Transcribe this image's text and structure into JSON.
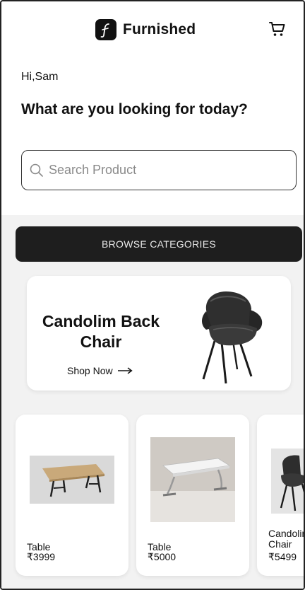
{
  "app": {
    "brand": "Furnished"
  },
  "greeting": "Hi,Sam",
  "headline": "What are you looking for today?",
  "search": {
    "placeholder": "Search Product",
    "value": ""
  },
  "browse_label": "BROWSE CATEGORIES",
  "banner": {
    "title": "Candolim Back Chair",
    "cta": "Shop Now"
  },
  "products": [
    {
      "name": "Table",
      "price": "₹3999"
    },
    {
      "name": "Table",
      "price": "₹5000"
    },
    {
      "name": "Candolim Chair",
      "price": "₹5499"
    }
  ],
  "icons": [
    "logo-icon",
    "cart-icon",
    "search-icon",
    "arrow-right-icon"
  ],
  "colors": {
    "dark": "#1e1e1e",
    "background": "#f2f2f2",
    "card": "#ffffff"
  }
}
